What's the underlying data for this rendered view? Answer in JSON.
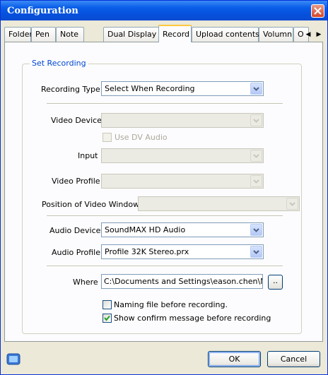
{
  "window": {
    "title": "Configuration"
  },
  "tabs": [
    {
      "label": "Folder"
    },
    {
      "label": "Pen"
    },
    {
      "label": "Note"
    },
    {
      "label": "Dual Display"
    },
    {
      "label": "Record",
      "active": true
    },
    {
      "label": "Upload contents"
    },
    {
      "label": "Volumn"
    },
    {
      "label": "O"
    }
  ],
  "group": {
    "label": "Set Recording"
  },
  "form": {
    "recording_type": {
      "label": "Recording Type",
      "value": "Select When Recording"
    },
    "video_device": {
      "label": "Video Device",
      "value": ""
    },
    "use_dv_audio": {
      "label": "Use DV Audio",
      "checked": false
    },
    "input": {
      "label": "Input",
      "value": ""
    },
    "video_profile": {
      "label": "Video Profile",
      "value": ""
    },
    "video_window": {
      "label": "Position of Video Window",
      "value": ""
    },
    "audio_device": {
      "label": "Audio Device",
      "value": "SoundMAX HD Audio"
    },
    "audio_profile": {
      "label": "Audio Profile",
      "value": "Profile 32K Stereo.prx"
    },
    "where": {
      "label": "Where",
      "value": "C:\\Documents and Settings\\eason.chen\\My",
      "browse": ".."
    },
    "naming_file": {
      "label": "Naming file before recording.",
      "checked": false
    },
    "show_confirm": {
      "label": "Show confirm message before recording",
      "checked": true
    }
  },
  "footer": {
    "ok": "OK",
    "cancel": "Cancel"
  }
}
